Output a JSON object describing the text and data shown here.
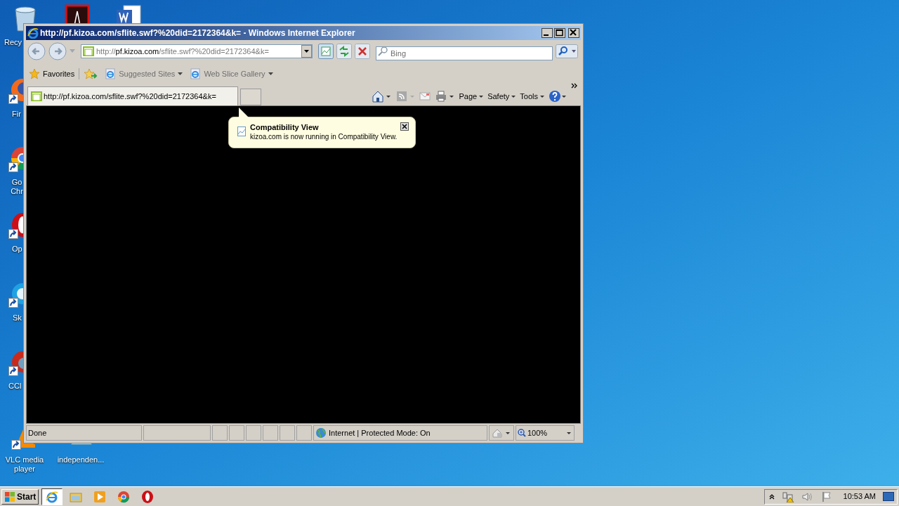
{
  "desktop_icons": [
    {
      "kind": "recycle",
      "label": "Recy",
      "shortcut": false
    },
    {
      "kind": "pdf",
      "shortcut": false
    },
    {
      "kind": "word",
      "shortcut": false
    },
    {
      "kind": "firefox",
      "label": "Fir",
      "shortcut": true
    },
    {
      "kind": "chrome",
      "label": "Go Chr",
      "shortcut": true
    },
    {
      "kind": "opera",
      "label": "Op",
      "shortcut": true
    },
    {
      "kind": "skype",
      "label": "Sk",
      "shortcut": true
    },
    {
      "kind": "ccleaner",
      "label": "CCl",
      "shortcut": true
    },
    {
      "kind": "vlc",
      "label": "VLC media player",
      "shortcut": true
    },
    {
      "kind": "file",
      "label": "independen...",
      "shortcut": false
    }
  ],
  "window": {
    "title": "http://pf.kizoa.com/sflite.swf?%20did=2172364&k= - Windows Internet Explorer",
    "address": "http://**pf.kizoa.com**/sflite.swf?%20did=2172364&k=",
    "search": {
      "placeholder": "Bing"
    },
    "favorites_bar": [
      {
        "kind": "favorites",
        "label": "Favorites"
      },
      {
        "kind": "add"
      },
      {
        "kind": "site",
        "label": "Suggested Sites",
        "dropdown": true
      },
      {
        "kind": "site",
        "label": "Web Slice Gallery",
        "dropdown": true
      }
    ],
    "tabs": [
      {
        "label": "http://pf.kizoa.com/sflite.swf?%20did=2172364&k=",
        "selected": true
      },
      {
        "selected": false,
        "kind": "new"
      }
    ],
    "command_bar": [
      {
        "kind": "home"
      },
      {
        "kind": "feeds",
        "disabled": true
      },
      {
        "kind": "mail",
        "disabled": true
      },
      {
        "kind": "print"
      },
      {
        "kind": "menu",
        "label": "Page"
      },
      {
        "kind": "menu",
        "label": "Safety"
      },
      {
        "kind": "menu",
        "label": "Tools"
      },
      {
        "kind": "help"
      }
    ],
    "notification": {
      "title": "Compatibility View",
      "text": "kizoa.com is now running in Compatibility View."
    },
    "status_bar": {
      "status": "Done",
      "zone": "Internet | Protected Mode: On",
      "zoom": "100%"
    }
  },
  "taskbar": {
    "start": "Start",
    "items": [
      {
        "kind": "ie",
        "selected": true
      },
      {
        "kind": "explorer",
        "selected": false
      },
      {
        "kind": "media",
        "selected": false
      },
      {
        "kind": "chrome",
        "selected": false
      },
      {
        "kind": "opera",
        "selected": false
      }
    ],
    "clock": "10:53 AM"
  }
}
